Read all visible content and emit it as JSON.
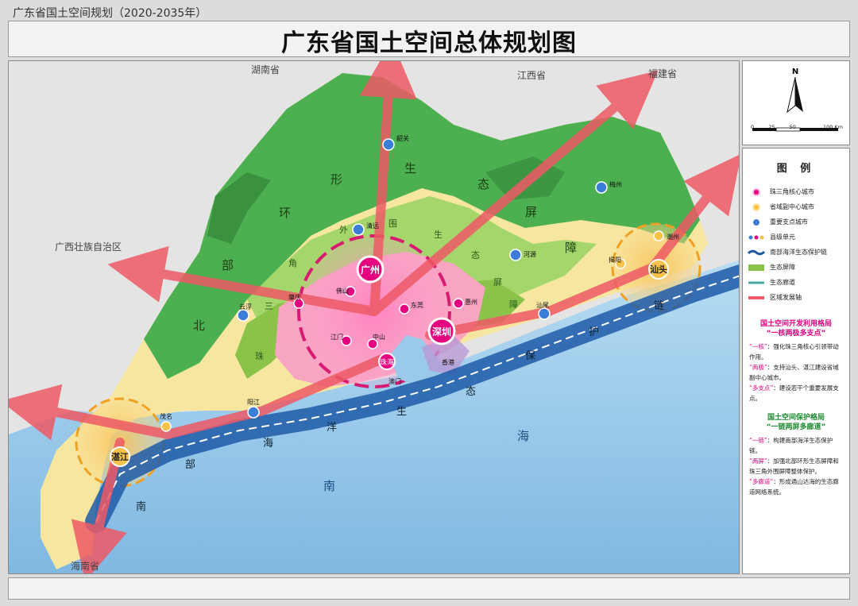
{
  "header": {
    "subtitle": "广东省国土空间规划（2020-2035年）",
    "title": "广东省国土空间总体规划图"
  },
  "neighbors": [
    "湖南省",
    "江西省",
    "福建省",
    "广西壮族自治区",
    "海南省"
  ],
  "core_cities": [
    "广州",
    "深圳"
  ],
  "vice_centers": [
    "汕头",
    "湛江"
  ],
  "node_cities": [
    "韶关",
    "清远",
    "肇庆",
    "佛山",
    "东莞",
    "惠州",
    "河源",
    "梅州",
    "汕尾",
    "云浮",
    "阳江",
    "茂名",
    "江门",
    "中山",
    "珠海",
    "潮州",
    "揭阳"
  ],
  "other_labels": [
    "香港",
    "澳门"
  ],
  "eco_ring_text": [
    "北",
    "部",
    "环",
    "形",
    "生",
    "态",
    "屏",
    "障"
  ],
  "delta_ring_text": [
    "珠",
    "三",
    "角",
    "外",
    "围",
    "生",
    "态",
    "屏",
    "障"
  ],
  "sea_chain_text": [
    "南",
    "部",
    "海",
    "洋",
    "生",
    "态",
    "保",
    "护",
    "链"
  ],
  "sea_labels": [
    "南",
    "海"
  ],
  "compass": {
    "north": "N",
    "ticks": [
      "0",
      "25",
      "50",
      "100 Km"
    ]
  },
  "legend": {
    "title": "图  例",
    "items": [
      {
        "label": "珠三角核心城市",
        "icon": "core-city-icon"
      },
      {
        "label": "省域副中心城市",
        "icon": "vice-center-icon"
      },
      {
        "label": "重要支点城市",
        "icon": "node-city-icon"
      },
      {
        "label": "县级单元",
        "icon": "county-unit-icon"
      },
      {
        "label": "南部海洋生态保护链",
        "icon": "sea-chain-icon"
      },
      {
        "label": "生态屏障",
        "icon": "eco-barrier-icon"
      },
      {
        "label": "生态廊道",
        "icon": "eco-corridor-icon"
      },
      {
        "label": "区域发展轴",
        "icon": "development-axis-icon"
      }
    ]
  },
  "dev_pattern": {
    "title": "国土空间开发利用格局",
    "subtitle": "“一核两极多支点”",
    "lines": [
      {
        "key": "“一核”",
        "text": "：强化珠三角核心引领带动作用。"
      },
      {
        "key": "“两极”",
        "text": "：支持汕头、湛江建设省域副中心城市。"
      },
      {
        "key": "“多支点”",
        "text": "：建设若干个重要发展支点。"
      }
    ]
  },
  "protect_pattern": {
    "title": "国土空间保护格局",
    "subtitle": "“一链两屏多廊道”",
    "lines": [
      {
        "key": "“一链”",
        "text": "：构建南部海洋生态保护链。"
      },
      {
        "key": "“两屏”",
        "text": "：加强北部环形生态屏障和珠三角外围屏障整体保护。"
      },
      {
        "key": "“多廊道”",
        "text": "：形成通山达海的生态廊道网络系统。"
      }
    ]
  },
  "colors": {
    "forest": "#4caf50",
    "forest_dark": "#2e7d32",
    "eco_barrier": "#8bc34a",
    "delta": "#f8a5c2",
    "core": "#e4007f",
    "vice": "#f7c14a",
    "node": "#3b7dd8",
    "axis": "#ee4a5a",
    "sea": "#8fc3e8",
    "sea_chain": "#1e5aa8",
    "coastal_land": "#f6e6a0"
  }
}
